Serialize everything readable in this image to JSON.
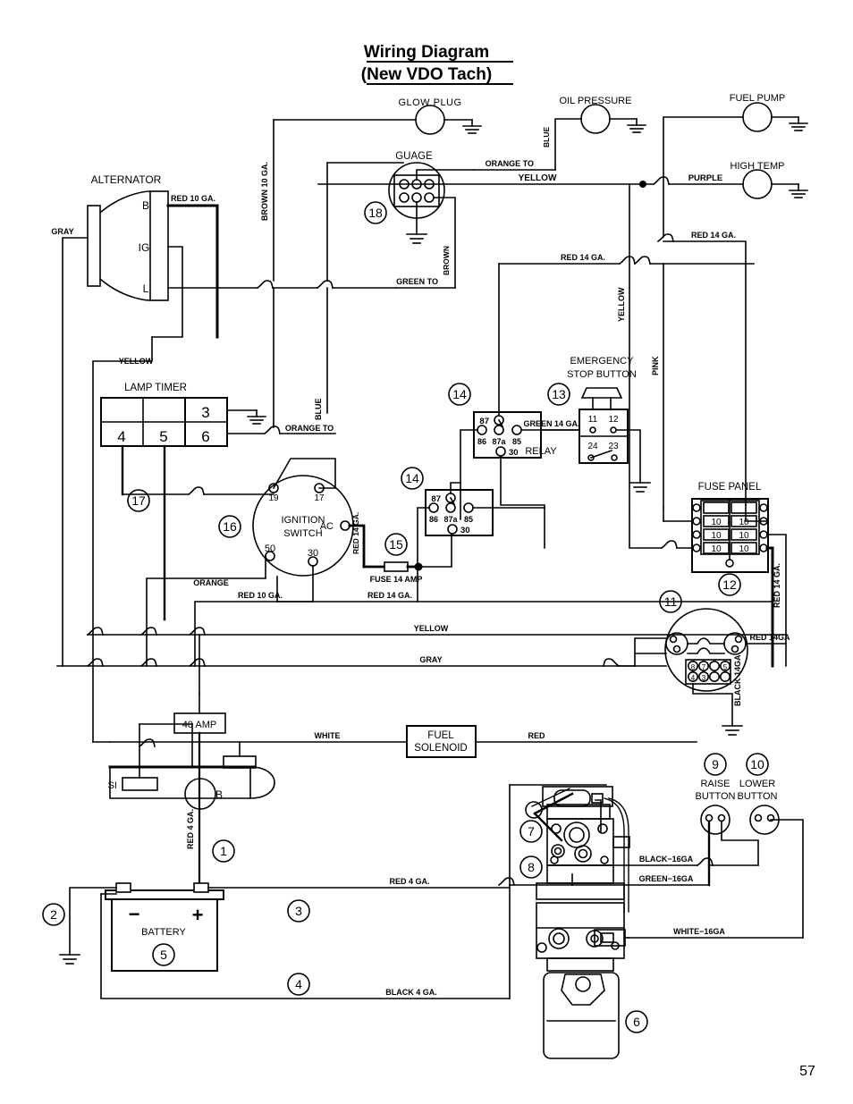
{
  "page": {
    "title_line1": "Wiring Diagram",
    "title_line2": "(New VDO Tach)",
    "page_number": "57"
  },
  "components": {
    "glow_plug": "GLOW  PLUG",
    "oil_pressure": "OIL  PRESSURE",
    "fuel_pump": "FUEL  PUMP",
    "high_temp": "HIGH  TEMP",
    "guage": "GUAGE",
    "alternator": "ALTERNATOR",
    "alternator_terminals": [
      "B",
      "IG",
      "L"
    ],
    "lamp_timer": "LAMP  TIMER",
    "lamp_timer_cells": [
      "",
      "",
      "3",
      "4",
      "5",
      "6"
    ],
    "ignition_switch_line1": "IGNITION",
    "ignition_switch_line2": "SWITCH",
    "ignition_terminals": [
      "19",
      "17",
      "AC",
      "50",
      "30"
    ],
    "emergency_stop_line1": "EMERGENCY",
    "emergency_stop_line2": "STOP  BUTTON",
    "estop_terminals": [
      "11",
      "12",
      "24",
      "23"
    ],
    "relay": "RELAY",
    "relay_terminals": [
      "87",
      "86",
      "87a",
      "85",
      "30"
    ],
    "fuse_panel": "FUSE  PANEL",
    "fuse_values": [
      "10",
      "10",
      "10",
      "10",
      "10",
      "10"
    ],
    "fuse_14_amp": "FUSE  14  AMP",
    "amp_40": "40  AMP",
    "si_label": "SI",
    "starter_b": "B",
    "fuel_solenoid_line1": "FUEL",
    "fuel_solenoid_line2": "SOLENOID",
    "battery": "BATTERY",
    "battery_minus": "−",
    "battery_plus": "+",
    "raise_button_line1": "RAISE",
    "raise_button_line2": "BUTTON",
    "lower_button_line1": "LOWER",
    "lower_button_line2": "BUTTON",
    "tach_pins": [
      "8",
      "7",
      "5",
      "4",
      "3"
    ]
  },
  "wire_labels": {
    "gray_alt": "GRAY",
    "red_10_ga_alt": "RED  10  GA.",
    "yellow_alt": "YELLOW",
    "brown_10_ga": "BROWN  10  GA.",
    "blue_vert": "BLUE",
    "blue_oil": "BLUE",
    "orange_to_oil": "ORANGE  TO",
    "yellow_top": "YELLOW",
    "purple": "PURPLE",
    "red_14_ga_right": "RED  14  GA.",
    "red_14_ga_mid": "RED  14  GA.",
    "brown_guage": "BROWN",
    "green_to": "GREEN  TO",
    "orange_to_switch": "ORANGE  TO",
    "yellow_vert": "YELLOW",
    "pink_vert": "PINK",
    "green_14_ga": "GREEN  14  GA.",
    "red_14_ga_vert": "RED  14  GA.",
    "red_14_ga_bottom": "RED  14  GA.",
    "red_14_ga_fusepanel": "RED  14  GA.",
    "orange_lower": "ORANGE",
    "red_10_ga_lower": "RED  10  GA.",
    "yellow_lower": "YELLOW",
    "gray_lower": "GRAY",
    "red_14ga_tach": "RED  14GA",
    "black_14ga_tach": "BLACK  14GA",
    "white_solenoid": "WHITE",
    "red_solenoid": "RED",
    "red_4_ga_vert": "RED  4  GA.",
    "red_4_ga_batt": "RED  4  GA.",
    "black_4_ga": "BLACK  4  GA.",
    "black_16ga": "BLACK−16GA",
    "green_16ga": "GREEN−16GA",
    "white_16ga": "WHITE−16GA"
  },
  "callouts": {
    "c1": "1",
    "c2": "2",
    "c3": "3",
    "c4": "4",
    "c5": "5",
    "c6": "6",
    "c7": "7",
    "c8": "8",
    "c9": "9",
    "c10": "10",
    "c11": "11",
    "c12": "12",
    "c13": "13",
    "c14a": "14",
    "c14b": "14",
    "c15": "15",
    "c16": "16",
    "c17": "17",
    "c18": "18"
  }
}
